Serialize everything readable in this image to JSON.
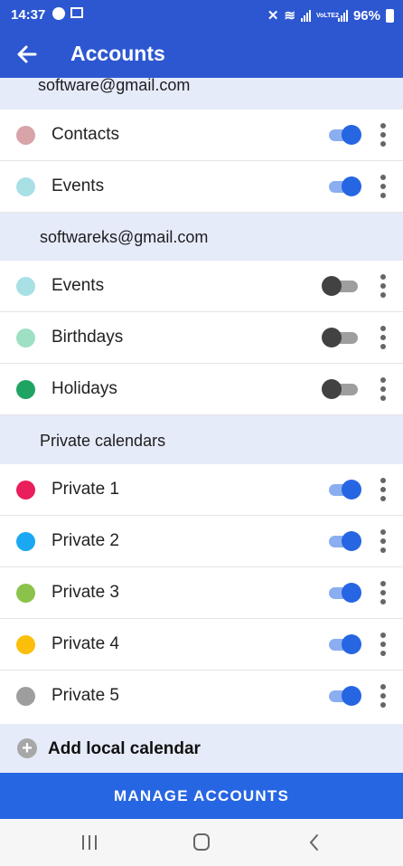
{
  "status_bar": {
    "time": "14:37",
    "battery": "96%",
    "signal_label": "VoLTE2"
  },
  "app_bar": {
    "title": "Accounts"
  },
  "sections": [
    {
      "header": "software@gmail.com"
    },
    {
      "header": "softwareks@gmail.com"
    },
    {
      "header": "Private calendars"
    }
  ],
  "rows": [
    {
      "label": "Contacts",
      "color": "#d8a3a9",
      "enabled": true
    },
    {
      "label": "Events",
      "color": "#a8e0e6",
      "enabled": true
    },
    {
      "label": "Events",
      "color": "#a8e0e6",
      "enabled": false
    },
    {
      "label": "Birthdays",
      "color": "#9ee0c4",
      "enabled": false
    },
    {
      "label": "Holidays",
      "color": "#1fa363",
      "enabled": false
    },
    {
      "label": "Private 1",
      "color": "#e91e5b",
      "enabled": true
    },
    {
      "label": "Private 2",
      "color": "#1aa8f2",
      "enabled": true
    },
    {
      "label": "Private 3",
      "color": "#8bc34a",
      "enabled": true
    },
    {
      "label": "Private 4",
      "color": "#fbbe0a",
      "enabled": true
    },
    {
      "label": "Private 5",
      "color": "#9e9e9e",
      "enabled": true
    }
  ],
  "add_calendar": {
    "label": "Add local calendar"
  },
  "manage_button": {
    "label": "MANAGE ACCOUNTS"
  },
  "nav": {
    "icons": [
      "recents-icon",
      "home-icon",
      "back-icon"
    ]
  }
}
